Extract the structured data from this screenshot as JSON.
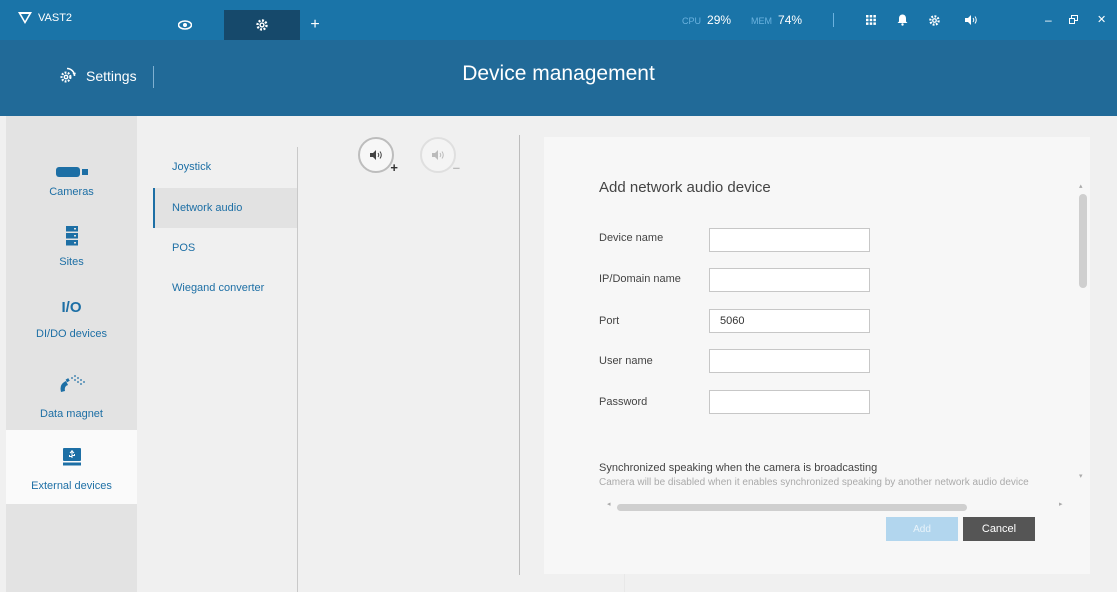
{
  "app": {
    "name": "VAST2"
  },
  "topbar": {
    "cpu_label": "CPU",
    "cpu_value": "29%",
    "mem_label": "MEM",
    "mem_value": "74%",
    "add_tab": "+"
  },
  "header": {
    "section": "Settings",
    "title": "Device management"
  },
  "leftnav": {
    "items": [
      {
        "label": "Cameras",
        "icon": "camera-icon"
      },
      {
        "label": "Sites",
        "icon": "server-icon"
      },
      {
        "label": "DI/DO devices",
        "icon": "io-icon",
        "glyph": "I/O"
      },
      {
        "label": "Data magnet",
        "icon": "magnet-icon"
      },
      {
        "label": "External devices",
        "icon": "external-device-icon"
      }
    ]
  },
  "subnav": {
    "items": [
      {
        "label": "Joystick"
      },
      {
        "label": "Network audio"
      },
      {
        "label": "POS"
      },
      {
        "label": "Wiegand converter"
      }
    ]
  },
  "form": {
    "title": "Add network audio device",
    "fields": [
      {
        "label": "Device name",
        "value": ""
      },
      {
        "label": "IP/Domain name",
        "value": ""
      },
      {
        "label": "Port",
        "value": "5060"
      },
      {
        "label": "User name",
        "value": ""
      },
      {
        "label": "Password",
        "value": ""
      }
    ],
    "sync_label": "Synchronized speaking when the camera is broadcasting",
    "sync_desc": "Camera will be disabled when it enables synchronized speaking by another network audio device",
    "add_label": "Add",
    "cancel_label": "Cancel"
  },
  "colors": {
    "topbar": "#1a74a8",
    "header": "#216a98",
    "accent": "#1d6fa5"
  }
}
